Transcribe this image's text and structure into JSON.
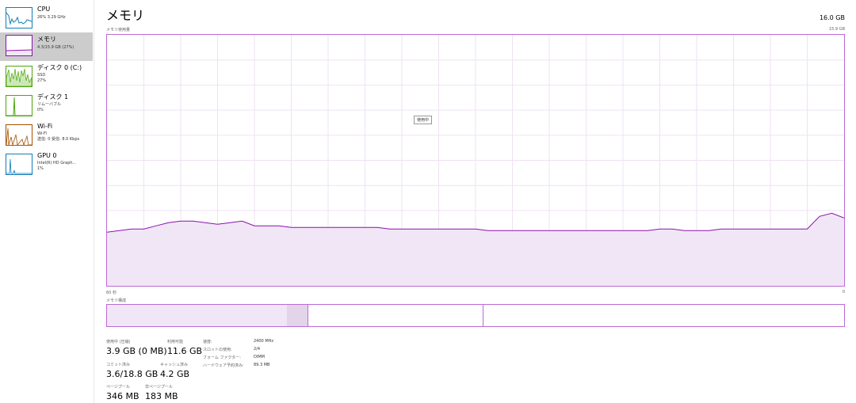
{
  "sidebar": {
    "items": [
      {
        "title": "CPU",
        "sub1": "26%  3.29 GHz",
        "sub2": "",
        "color": "#117dbb"
      },
      {
        "title": "メモリ",
        "sub1": "4.3/15.9 GB (27%)",
        "sub2": "",
        "color": "#8b12ae"
      },
      {
        "title": "ディスク 0 (C:)",
        "sub1": "SSD",
        "sub2": "27%",
        "color": "#4da60c"
      },
      {
        "title": "ディスク 1",
        "sub1": "リムーバブル",
        "sub2": "0%",
        "color": "#4da60c"
      },
      {
        "title": "Wi-Fi",
        "sub1": "Wi-Fi",
        "sub2": "送信: 0 受信: 8.0 Kbps",
        "color": "#a74f01"
      },
      {
        "title": "GPU 0",
        "sub1": "Intel(R) HD Graph...",
        "sub2": "1%",
        "color": "#117dbb"
      }
    ],
    "selected_index": 1
  },
  "header": {
    "title": "メモリ",
    "total": "16.0 GB",
    "graph_label": "メモリ使用量",
    "graph_max": "15.9 GB",
    "graph_time": "60 秒",
    "graph_min": "0",
    "tooltip": "使用中"
  },
  "composition": {
    "label": "メモリ構成",
    "segments": [
      {
        "name": "使用中",
        "fraction": 0.244
      },
      {
        "name": "変更済み",
        "fraction": 0.028
      },
      {
        "name": "スタンバイ",
        "fraction": 0.238
      },
      {
        "name": "空き",
        "fraction": 0.49
      }
    ]
  },
  "stats": {
    "in_use_label": "使用中 (圧縮)",
    "in_use_value": "3.9 GB (0 MB)",
    "available_label": "利用可能",
    "available_value": "11.6 GB",
    "committed_label": "コミット済み",
    "committed_value": "3.6/18.8 GB",
    "cached_label": "キャッシュ済み",
    "cached_value": "4.2 GB",
    "paged_label": "ページプール",
    "paged_value": "346 MB",
    "nonpaged_label": "非ページプール",
    "nonpaged_value": "183 MB"
  },
  "specs": [
    {
      "label": "速度:",
      "value": "2400 MHz"
    },
    {
      "label": "スロットの使用:",
      "value": "2/4"
    },
    {
      "label": "フォーム ファクター:",
      "value": "DIMM"
    },
    {
      "label": "ハードウェア予約済み:",
      "value": "89.3 MB"
    }
  ],
  "chart_data": {
    "type": "area",
    "ylim": [
      0,
      15.9
    ],
    "xlim": [
      60,
      0
    ],
    "grid": true,
    "x": [
      60,
      58,
      57,
      56,
      55,
      54,
      53,
      52,
      51,
      50,
      49,
      48,
      47,
      46,
      45,
      44,
      43,
      42,
      41,
      40,
      39,
      38,
      37,
      36,
      35,
      34,
      33,
      32,
      31,
      30,
      29,
      28,
      27,
      26,
      25,
      24,
      23,
      22,
      21,
      20,
      19,
      18,
      17,
      16,
      15,
      14,
      13,
      12,
      11,
      10,
      9,
      8,
      7,
      6,
      5,
      4,
      3,
      2,
      1,
      0
    ],
    "series": [
      {
        "values": [
          3.4,
          3.6,
          3.6,
          3.8,
          4.0,
          4.1,
          4.1,
          4.0,
          3.9,
          4.0,
          4.1,
          3.8,
          3.8,
          3.8,
          3.7,
          3.7,
          3.7,
          3.7,
          3.7,
          3.7,
          3.7,
          3.7,
          3.6,
          3.6,
          3.6,
          3.6,
          3.6,
          3.6,
          3.6,
          3.6,
          3.5,
          3.5,
          3.5,
          3.5,
          3.5,
          3.5,
          3.5,
          3.5,
          3.5,
          3.5,
          3.5,
          3.5,
          3.5,
          3.5,
          3.6,
          3.6,
          3.5,
          3.5,
          3.5,
          3.6,
          3.6,
          3.6,
          3.6,
          3.6,
          3.6,
          3.6,
          3.6,
          4.4,
          4.6,
          4.3
        ]
      }
    ]
  }
}
